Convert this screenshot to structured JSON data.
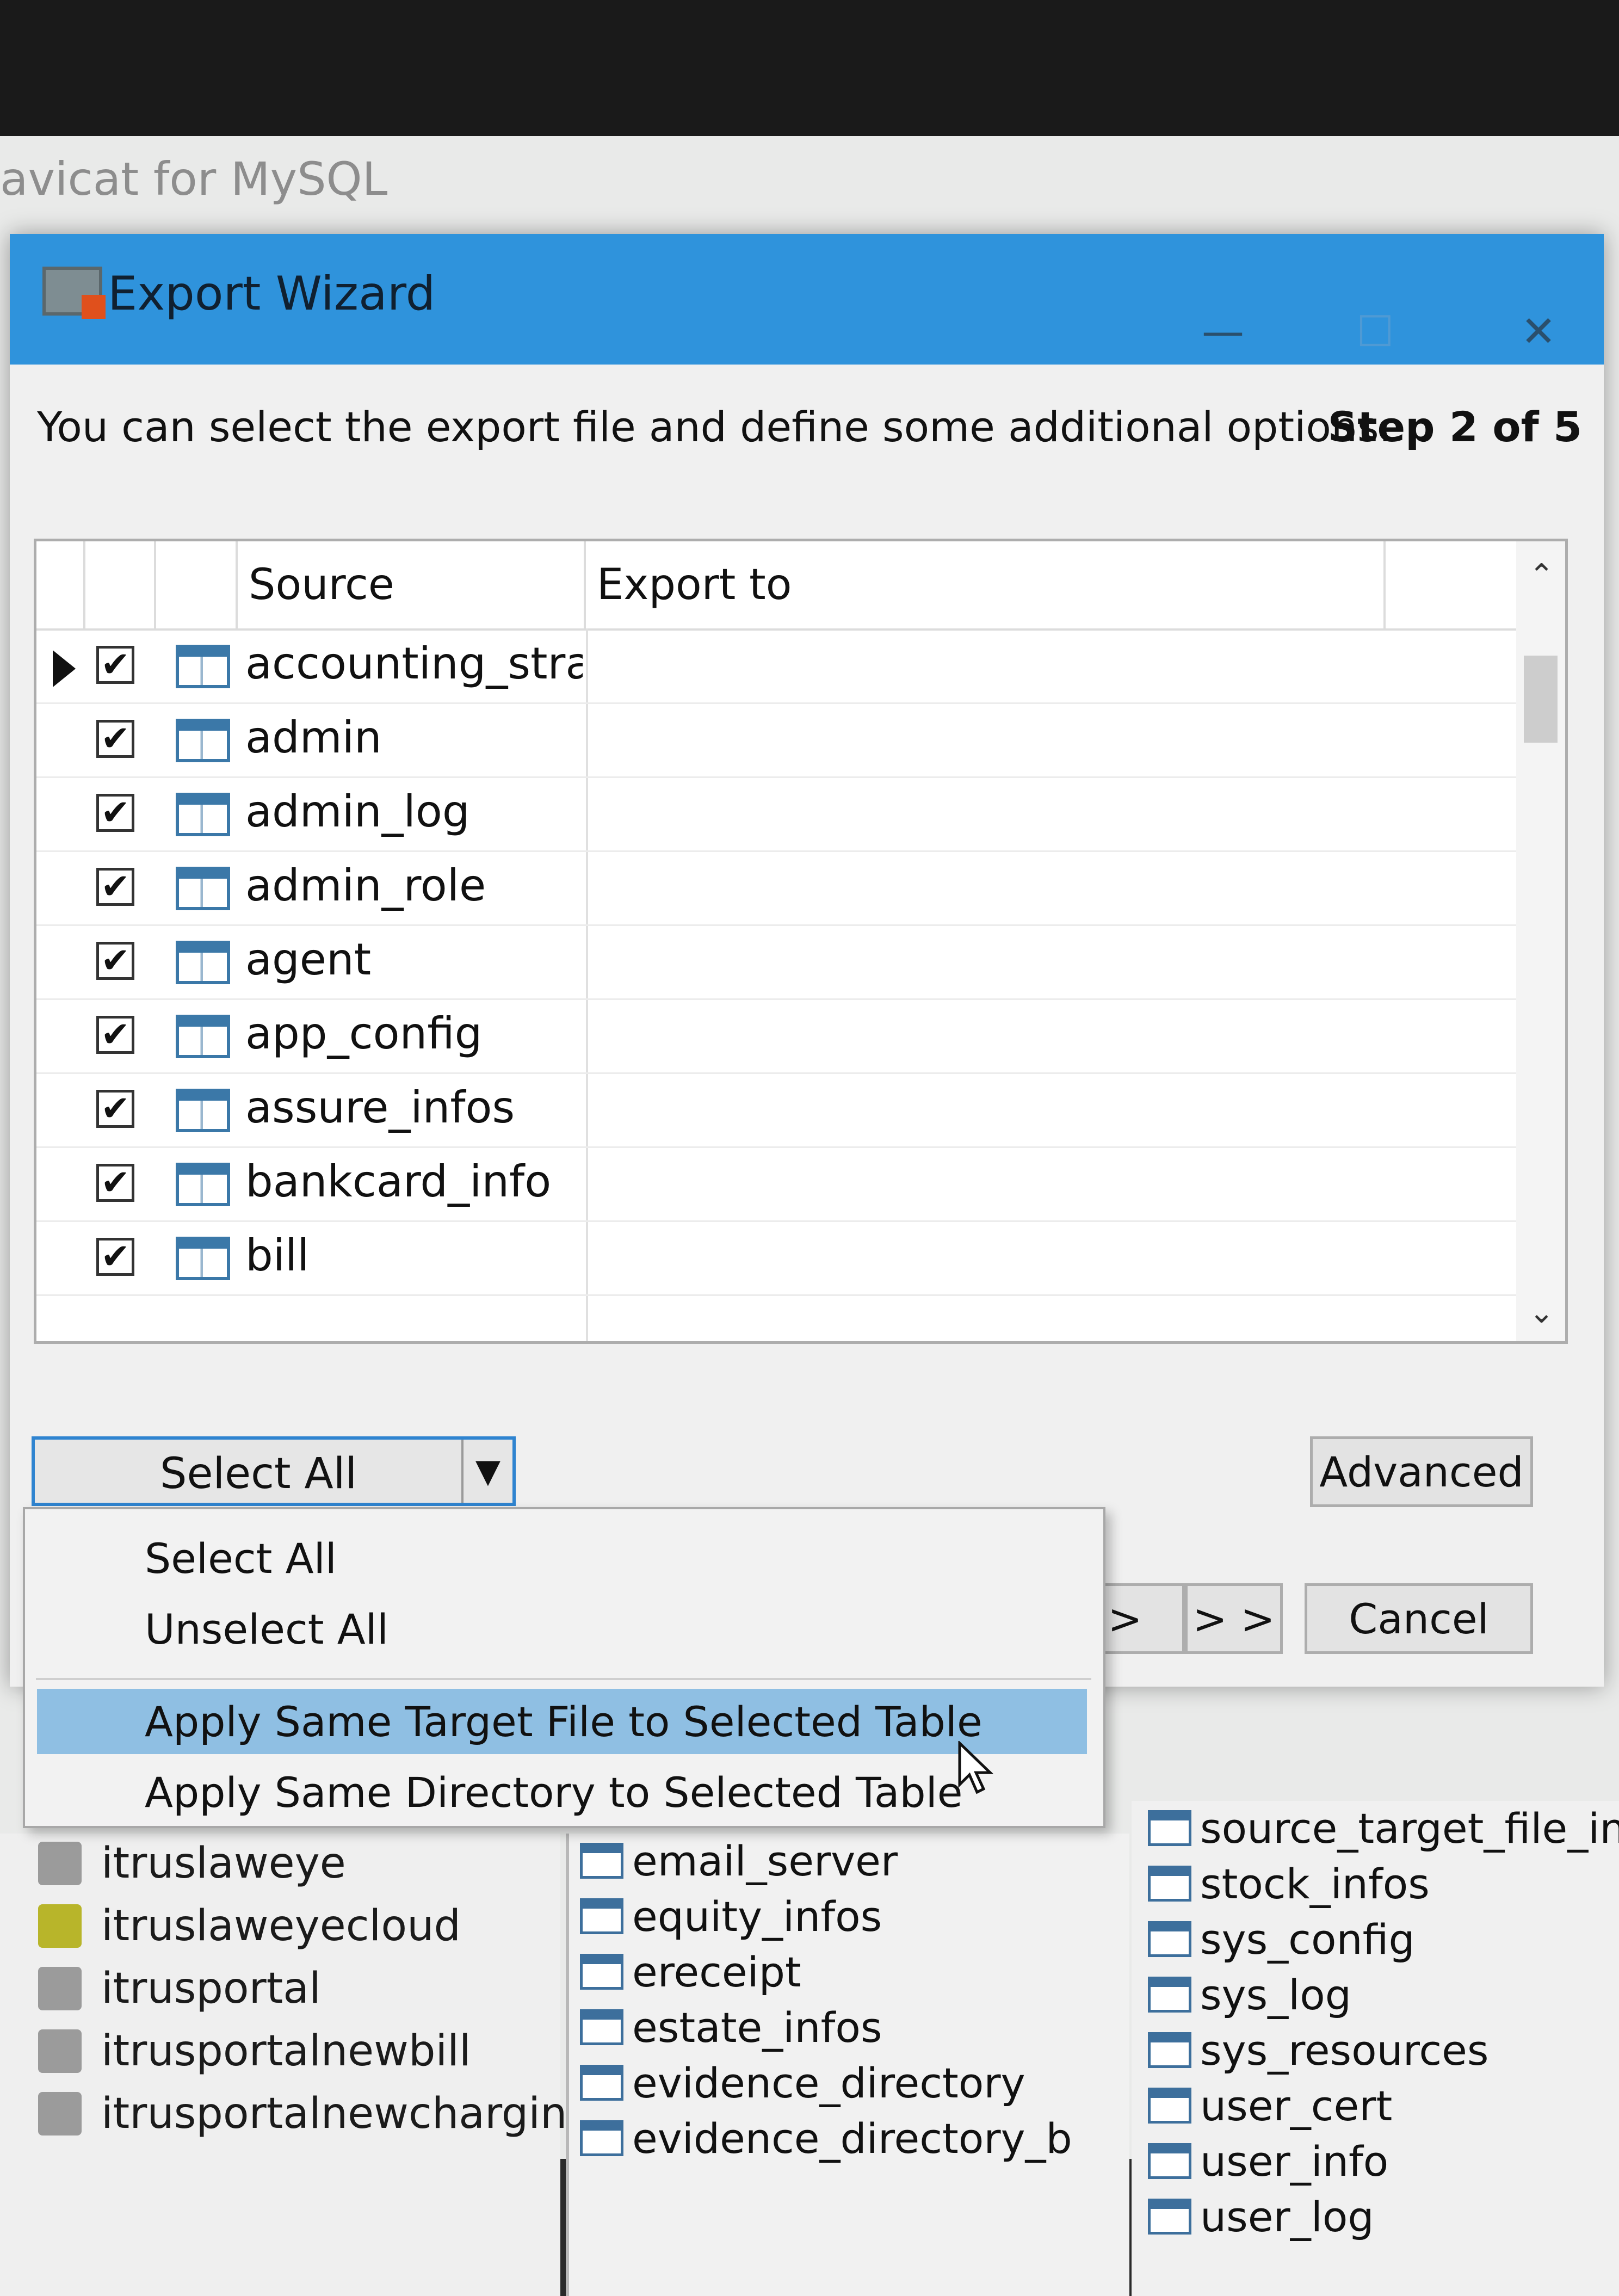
{
  "app": {
    "title": "avicat for MySQL"
  },
  "dialog": {
    "title": "Export Wizard",
    "minimize": "—",
    "maximize": "☐",
    "close": "✕",
    "step": "Step 2 of 5",
    "instruction": "You can select the export file and define some additional options."
  },
  "grid": {
    "headers": {
      "source": "Source",
      "export_to": "Export to"
    },
    "rows": [
      {
        "source": "accounting_strat",
        "checked": "✔"
      },
      {
        "source": "admin",
        "checked": "✔"
      },
      {
        "source": "admin_log",
        "checked": "✔"
      },
      {
        "source": "admin_role",
        "checked": "✔"
      },
      {
        "source": "agent",
        "checked": "✔"
      },
      {
        "source": "app_config",
        "checked": "✔"
      },
      {
        "source": "assure_infos",
        "checked": "✔"
      },
      {
        "source": "bankcard_info",
        "checked": "✔"
      },
      {
        "source": "bill",
        "checked": "✔"
      }
    ],
    "scroll_up": "⌃",
    "scroll_down": "⌄"
  },
  "controls": {
    "select_combo": "Select All",
    "combo_arrow": "▼",
    "advanced": "Advanced",
    "back": ">",
    "next": "> >",
    "cancel": "Cancel"
  },
  "menu": {
    "items": [
      "Select All",
      "Unselect All",
      "Apply Same Target File to Selected Table",
      "Apply Same Directory to Selected Table"
    ]
  },
  "background": {
    "databases": [
      "itruslaweye",
      "itruslaweyecloud",
      "itrusportal",
      "itrusportalnewbill",
      "itrusportalnewcharging"
    ],
    "tables_mid": [
      "email_server",
      "equity_infos",
      "ereceipt",
      "estate_infos",
      "evidence_directory",
      "evidence_directory_b"
    ],
    "tables_right": [
      "source_target_file_info",
      "stock_infos",
      "sys_config",
      "sys_log",
      "sys_resources",
      "user_cert",
      "user_info",
      "user_log"
    ]
  }
}
